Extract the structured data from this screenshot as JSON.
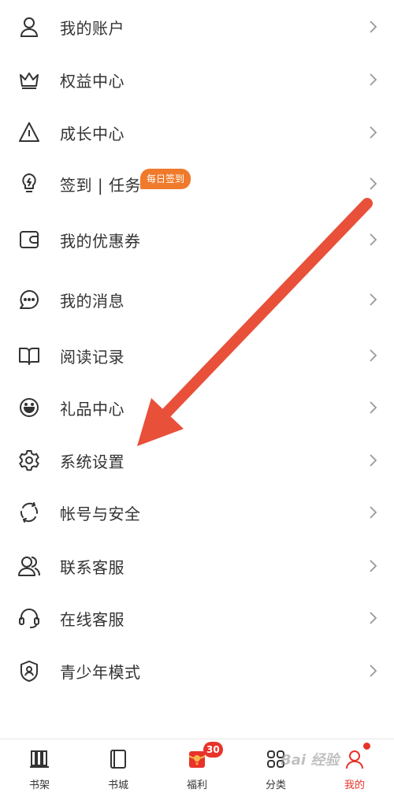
{
  "menu": {
    "items": [
      {
        "label": "我的账户",
        "icon": "user-icon"
      },
      {
        "label": "权益中心",
        "icon": "crown-icon"
      },
      {
        "label": "成长中心",
        "icon": "warning-triangle-icon"
      },
      {
        "label": "签到 | 任务",
        "icon": "lightbulb-icon",
        "badge": "每日签到"
      },
      {
        "label": "我的优惠券",
        "icon": "wallet-icon"
      },
      {
        "label": "我的消息",
        "icon": "chat-bubble-icon"
      },
      {
        "label": "阅读记录",
        "icon": "open-book-icon"
      },
      {
        "label": "礼品中心",
        "icon": "smiley-icon"
      },
      {
        "label": "系统设置",
        "icon": "gear-icon"
      },
      {
        "label": "帐号与安全",
        "icon": "refresh-icon"
      },
      {
        "label": "联系客服",
        "icon": "contacts-icon"
      },
      {
        "label": "在线客服",
        "icon": "headset-icon"
      },
      {
        "label": "青少年模式",
        "icon": "shield-user-icon"
      }
    ]
  },
  "tabbar": {
    "tabs": [
      {
        "label": "书架",
        "icon": "bookshelf-icon"
      },
      {
        "label": "书城",
        "icon": "book-icon"
      },
      {
        "label": "福利",
        "icon": "red-envelope-icon",
        "badge": "30"
      },
      {
        "label": "分类",
        "icon": "grid-icon"
      },
      {
        "label": "我的",
        "icon": "profile-icon",
        "active": true
      }
    ]
  },
  "watermark": "Bai 经验",
  "colors": {
    "accent": "#e8332a",
    "badge_orange": "#f07a2c",
    "arrow": "#e8503a",
    "icon_stroke": "#333333"
  }
}
